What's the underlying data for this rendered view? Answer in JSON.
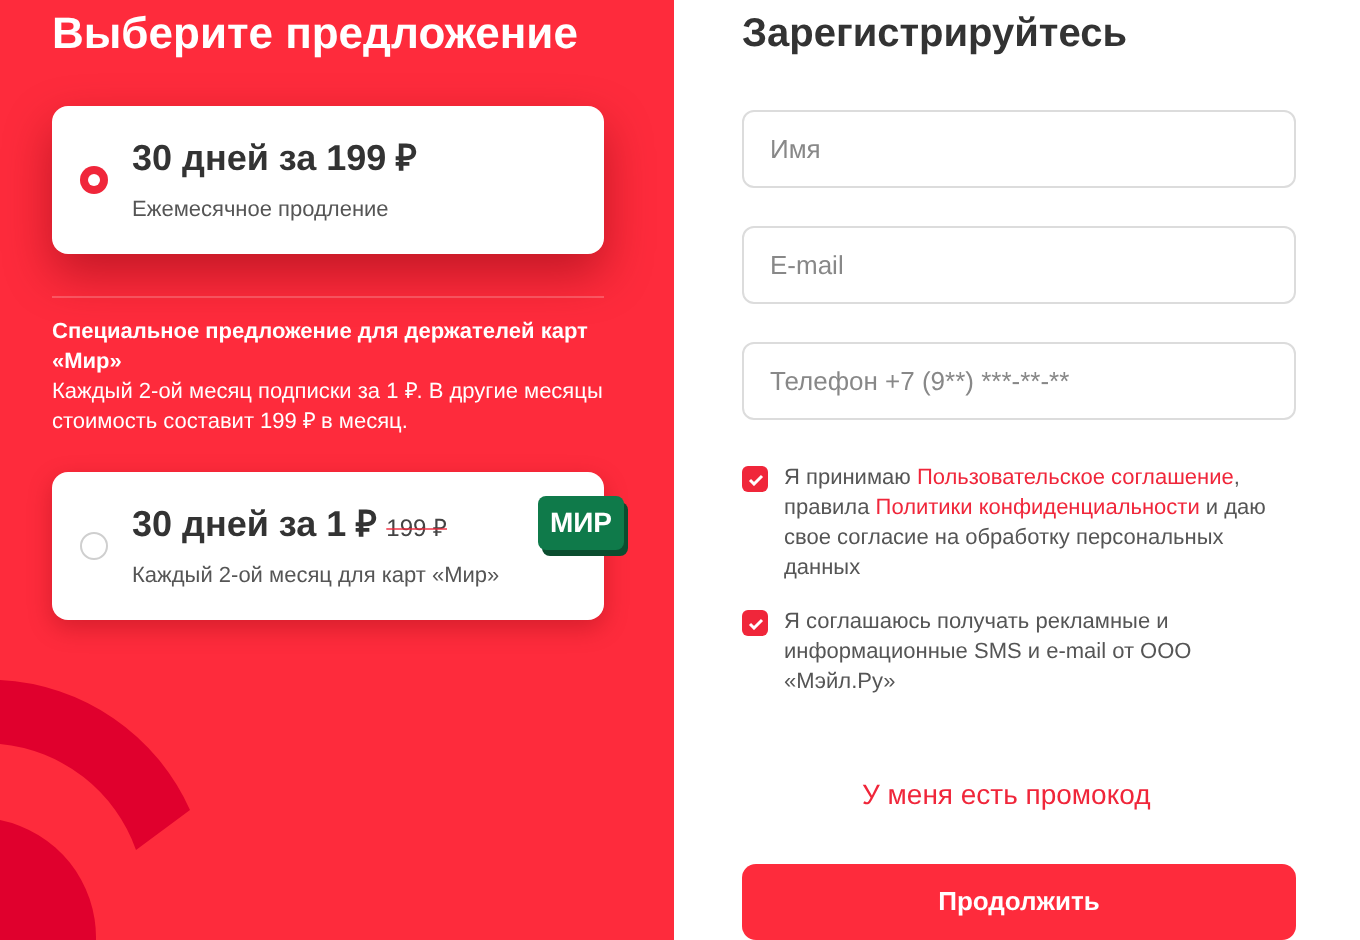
{
  "offer": {
    "title": "Выберите предложение",
    "plans": [
      {
        "kind": "regular",
        "selected": true,
        "title": "30 дней за 199 ₽",
        "subtitle": "Ежемесячное продление"
      },
      {
        "kind": "mir",
        "selected": false,
        "title": "30 дней за 1 ₽",
        "old_price": "199 ₽",
        "subtitle": "Каждый 2-ой месяц для карт «Мир»",
        "logo": "МИР"
      }
    ],
    "special_heading": "Специальное предложение для держателей карт «Мир»",
    "special_text": "Каждый 2-ой месяц подписки за 1 ₽. В другие месяцы стоимость составит 199 ₽ в месяц."
  },
  "signup": {
    "title": "Зарегистрируйтесь",
    "fields": [
      {
        "placeholder": "Имя"
      },
      {
        "placeholder": "E-mail"
      },
      {
        "placeholder": "Телефон +7 (9**) ***-**-**"
      }
    ],
    "consents": [
      {
        "checked": true,
        "parts": [
          {
            "kind": "text",
            "text": "Я принимаю "
          },
          {
            "kind": "link",
            "text": "Пользовательское соглашение"
          },
          {
            "kind": "text",
            "text": ", правила "
          },
          {
            "kind": "link",
            "text": "Политики конфиденциальности"
          },
          {
            "kind": "text",
            "text": " и даю свое согласие на обработку персональных данных"
          }
        ]
      },
      {
        "checked": true,
        "parts": [
          {
            "kind": "text",
            "text": "Я соглашаюсь получать рекламные и информационные SMS и e-mail от ООО «Мэйл.Ру»"
          }
        ]
      }
    ],
    "promo_link": "У меня есть промокод",
    "submit": "Продолжить"
  }
}
